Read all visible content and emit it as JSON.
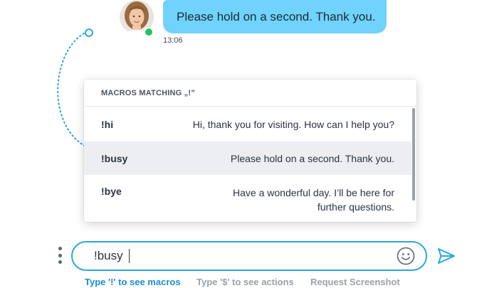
{
  "message": {
    "text": "Please hold on a second. Thank you.",
    "time": "13:06"
  },
  "macros": {
    "header": "MACROS MATCHING „!”",
    "items": [
      {
        "key": "!hi",
        "text": "Hi, thank you for visiting. How can I help you?"
      },
      {
        "key": "!busy",
        "text": "Please hold on a second. Thank you."
      },
      {
        "key": "!bye",
        "text": "Have a wonderful day. I’ll be here for further questions."
      }
    ],
    "highlighted_index": 1
  },
  "composer": {
    "value": "!busy"
  },
  "hints": {
    "macros": "Type '!' to see macros",
    "actions": "Type '$' to see actions",
    "screenshot": "Request Screenshot"
  },
  "colors": {
    "bubble": "#6fd3fb",
    "accent": "#29a8e0",
    "online": "#22c55e",
    "highlight_row": "#eceef1"
  },
  "icons": {
    "menu": "vertical-dots-icon",
    "emoji": "smiley-icon",
    "send": "paper-plane-icon",
    "status": "online-status-dot"
  }
}
